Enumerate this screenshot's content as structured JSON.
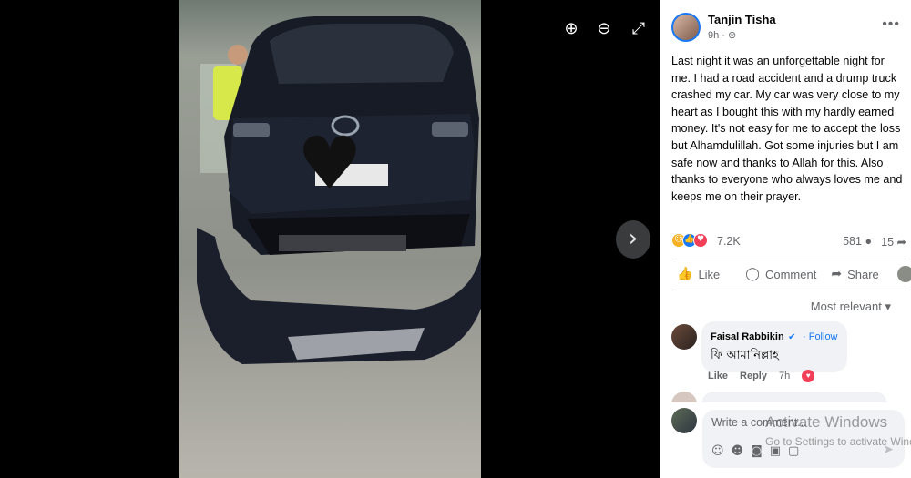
{
  "viewer": {
    "tools": {
      "zoom_in": "zoom-in-icon",
      "zoom_out": "zoom-out-icon",
      "fullscreen": "fullscreen-icon"
    },
    "next": "chevron-right-icon"
  },
  "post": {
    "author": "Tanjin Tisha",
    "time": "9h ·",
    "text": "Last night it was an unforgettable night for me. I had a road accident and a drump truck crashed my car. My car was very close to my heart as I bought this with my hardly earned money. It's not easy for me to accept the loss but Alhamdulillah. Got some injuries but I am safe now and thanks to Allah for this. Also thanks to everyone who always loves me and keeps me on their prayer.",
    "reaction_count": "7.2K",
    "comment_count": "581",
    "share_count": "15",
    "actions": {
      "like": "Like",
      "comment": "Comment",
      "share": "Share"
    },
    "sort_label": "Most relevant"
  },
  "comments": [
    {
      "name": "Faisal Rabbikin",
      "follow": "· Follow",
      "text": "ফি আমানিল্লাহ",
      "like": "Like",
      "reply": "Reply",
      "time": "7h"
    }
  ],
  "composer": {
    "placeholder": "Write a comment..."
  },
  "watermark": {
    "title": "Activate Windows",
    "subtitle": "Go to Settings to activate Windows."
  },
  "colors": {
    "accent": "#1877f2",
    "love": "#f33e58",
    "panel_bg": "#ffffff",
    "viewer_bg": "#000000"
  }
}
